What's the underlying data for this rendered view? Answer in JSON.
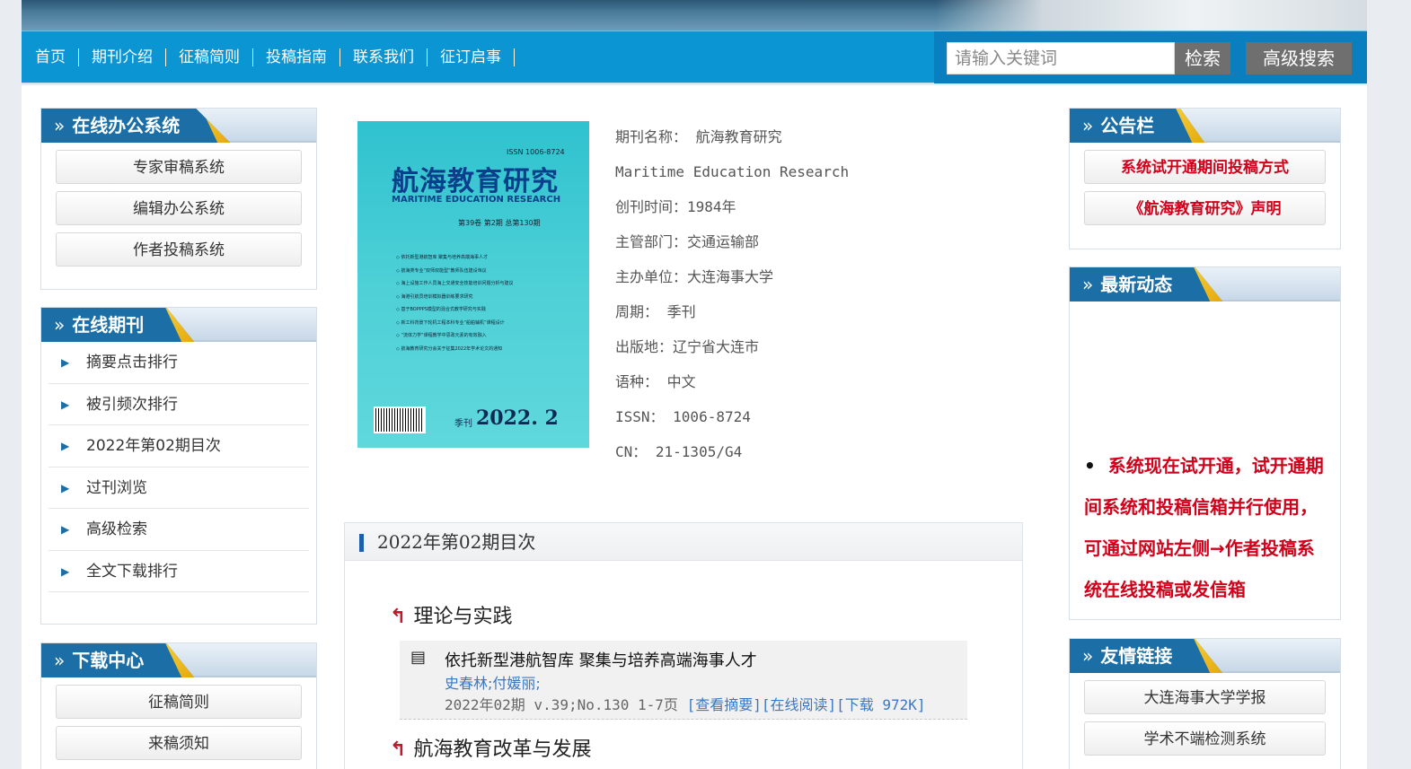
{
  "nav": {
    "items": [
      "首页",
      "期刊介绍",
      "征稿简则",
      "投稿指南",
      "联系我们",
      "征订启事"
    ],
    "search_placeholder": "请输入关键词",
    "search_button": "检索",
    "advanced_button": "高级搜索"
  },
  "left": {
    "office": {
      "title": "在线办公系统",
      "items": [
        "专家审稿系统",
        "编辑办公系统",
        "作者投稿系统"
      ]
    },
    "journal": {
      "title": "在线期刊",
      "items": [
        "摘要点击排行",
        "被引频次排行",
        "2022年第02期目次",
        "过刊浏览",
        "高级检索",
        "全文下载排行"
      ]
    },
    "download": {
      "title": "下载中心",
      "items": [
        "征稿简则",
        "来稿须知"
      ]
    }
  },
  "cover": {
    "issn": "ISSN 1006-8724",
    "title": "航海教育研究",
    "subtitle": "MARITIME EDUCATION RESEARCH",
    "volume": "第39卷 第2期 总第130期",
    "contents": [
      "依托新型港航智库 聚集与培养高端海事人才",
      "航海类专业“双师双能型”教师队伍建设刍议",
      "海上设施工作人员海上交通安全技能培训问题分析与建议",
      "海港引航员培训模拟器训练要求研究",
      "基于BOPPPS模型的混合式教学研究与实践",
      "新工科背景下轮机工程本科专业“船舶辅机”课程设计",
      "“流体力学”课程教学中思政元素的有效融入",
      "航海教育研究分会关于征集2022年学术论文的通知"
    ],
    "period_label": "季刊",
    "issue": "2022. 2"
  },
  "info": {
    "name": "期刊名称： 航海教育研究",
    "english": "Maritime Education Research",
    "founded": "创刊时间：1984年",
    "supervisor": "主管部门：交通运输部",
    "sponsor": "主办单位：大连海事大学",
    "period": "周期： 季刊",
    "place": "出版地：辽宁省大连市",
    "language": "语种： 中文",
    "issn": "ISSN： 1006-8724",
    "cn": "CN： 21-1305/G4"
  },
  "toc": {
    "title": "2022年第02期目次",
    "section1": "理论与实践",
    "section2": "航海教育改革与发展",
    "article": {
      "title": "依托新型港航智库 聚集与培养高端海事人才",
      "authors": "史春林;付媛丽;",
      "meta": "2022年02期 v.39;No.130 1-7页 ",
      "links": "[查看摘要][在线阅读][下载 972K]"
    }
  },
  "right": {
    "notice": {
      "title": "公告栏",
      "items": [
        "系统试开通期间投稿方式",
        "《航海教育研究》声明"
      ]
    },
    "news": {
      "title": "最新动态",
      "text": "系统现在试开通，试开通期间系统和投稿信箱并行使用，可通过网站左侧→作者投稿系统在线投稿或发信箱"
    },
    "links": {
      "title": "友情链接",
      "items": [
        "大连海事大学学报",
        "学术不端检测系统"
      ]
    }
  }
}
